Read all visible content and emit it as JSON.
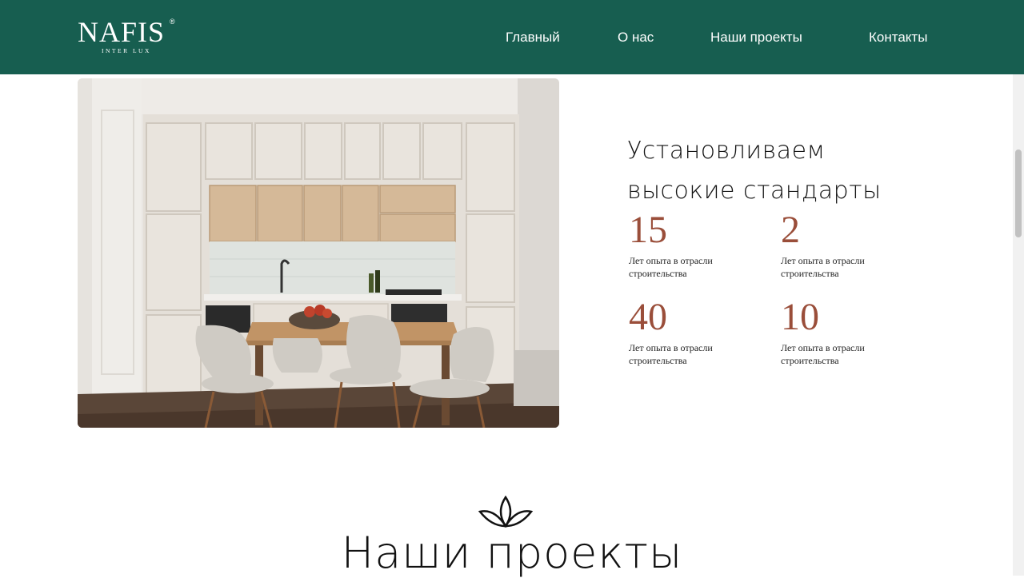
{
  "header": {
    "logo": {
      "name": "NAFIS",
      "registered": "®",
      "tagline": "INTER LUX"
    },
    "nav": [
      "Главный",
      "О нас",
      "Наши проекты",
      "Контакты"
    ],
    "bg_color": "#175e50"
  },
  "hero": {
    "image_alt": "kitchen-interior-image",
    "heading_line1": "Установливаем",
    "heading_line2": "высокие стандарты",
    "stats": [
      {
        "value": "15",
        "label": "Лет опыта в отрасли строительства"
      },
      {
        "value": "2",
        "label": "Лет опыта в отрасли строительства"
      },
      {
        "value": "40",
        "label": "Лет опыта в отрасли строительства"
      },
      {
        "value": "10",
        "label": "Лет опыта в отрасли строительства"
      }
    ],
    "accent_color": "#9a4e3a"
  },
  "projects": {
    "icon": "leaves-icon",
    "title": "Наши проекты"
  }
}
